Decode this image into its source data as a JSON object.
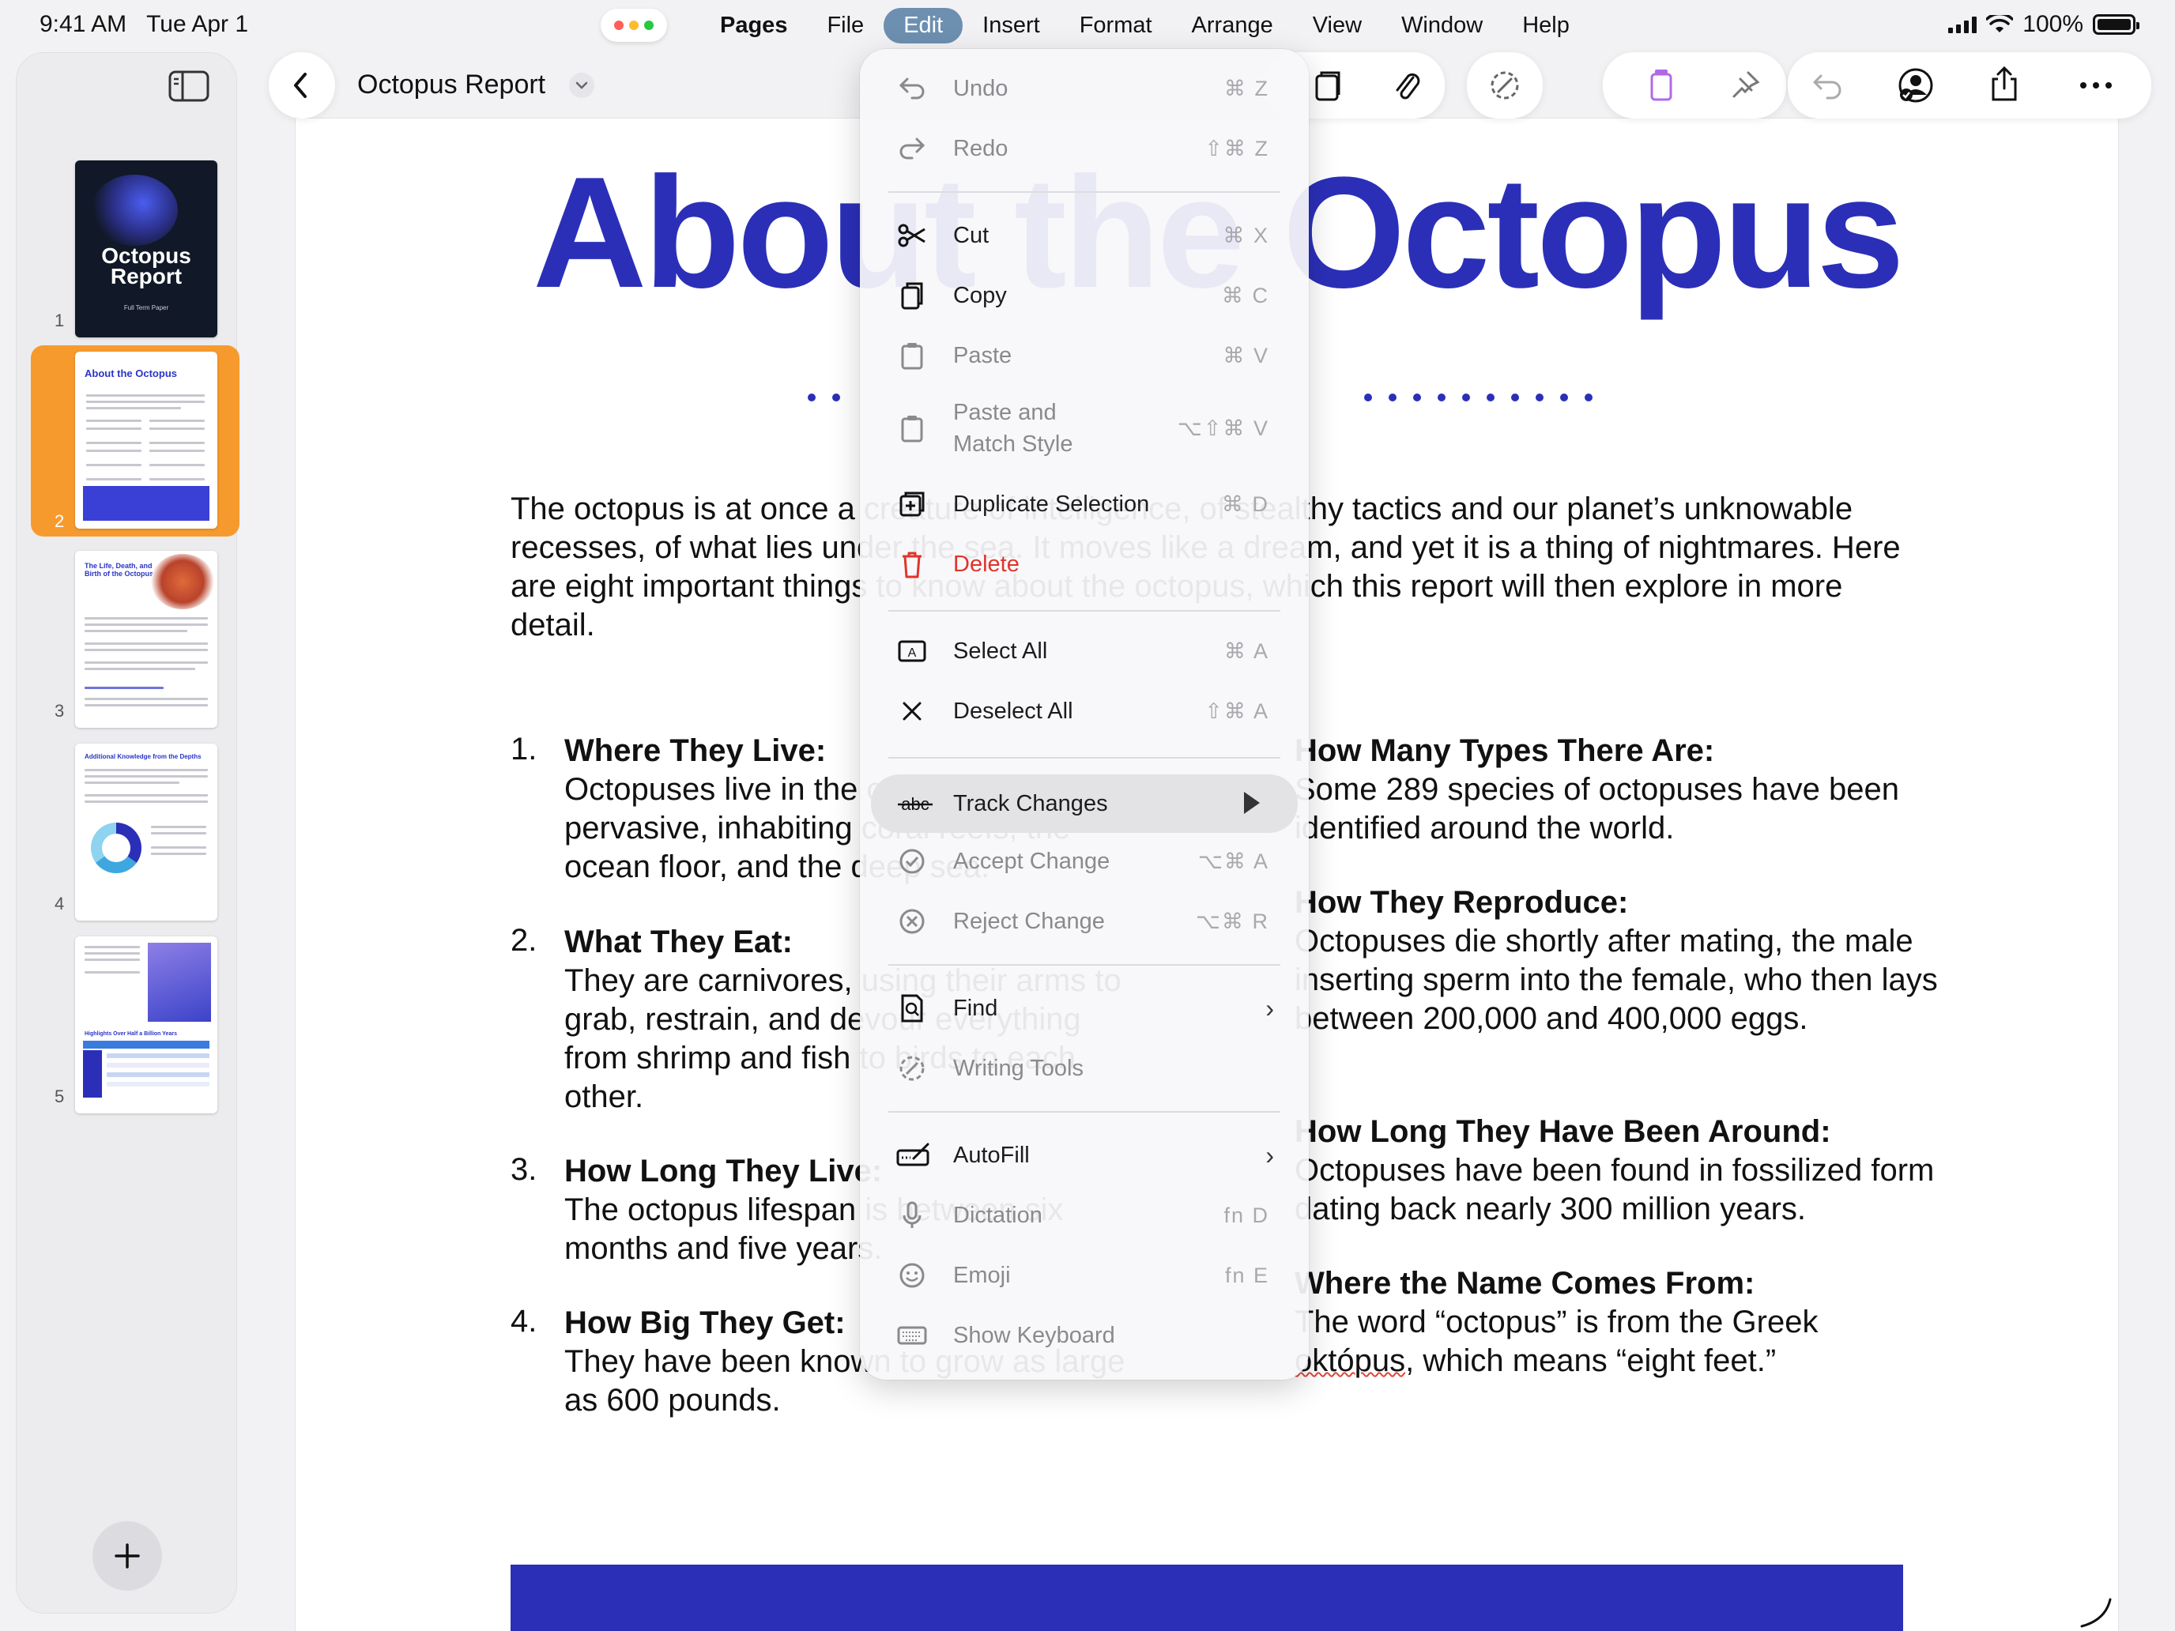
{
  "status": {
    "time": "9:41 AM",
    "date": "Tue Apr 1",
    "battery": "100%"
  },
  "menubar": {
    "items": [
      "Pages",
      "File",
      "Edit",
      "Insert",
      "Format",
      "Arrange",
      "View",
      "Window",
      "Help"
    ],
    "active": "Edit"
  },
  "toolbar": {
    "doc_title": "Octopus Report"
  },
  "sidebar": {
    "pages": [
      {
        "num": "1",
        "cover_title": "Octopus Report",
        "cover_sub": "Full Term Paper"
      },
      {
        "num": "2",
        "title": "About the Octopus"
      },
      {
        "num": "3",
        "title": "The Life, Death, and Birth of the Octopus"
      },
      {
        "num": "4",
        "title": "Additional Knowledge from the Depths"
      },
      {
        "num": "5",
        "title": "Highlights Over Half a Billion Years"
      }
    ],
    "selected_page": "2"
  },
  "document": {
    "heading": "About the Octopus",
    "intro": "The octopus is at once a creature of intelligence, of stealthy tactics and our planet’s unknowable recesses, of what lies under the sea. It moves like a dream, and yet it is a thing of nightmares. Here are eight important things to know about the octopus, which this report will then explore in more detail.",
    "left_list": [
      {
        "num": "1.",
        "title": "Where They Live:",
        "body": "Octopuses live in the ocean and are pervasive, inhabiting coral reefs, the ocean floor, and the deep sea."
      },
      {
        "num": "2.",
        "title": "What They Eat:",
        "body": "They are carnivores, using their arms to grab, restrain, and devour everything from shrimp and fish to birds to each other."
      },
      {
        "num": "3.",
        "title": "How Long They Live:",
        "body": "The octopus lifespan is between six months and five years."
      },
      {
        "num": "4.",
        "title": "How Big They Get:",
        "body": "They have been known to grow as large as 600 pounds."
      }
    ],
    "right_list": [
      {
        "title": "How Many Types There Are:",
        "body": "Some 289 species of octopuses have been identified around the world."
      },
      {
        "title": "How They Reproduce:",
        "body": "Octopuses die shortly after mating, the male inserting sperm into the female, who then lays between 200,000 and 400,000 eggs."
      },
      {
        "title": "How Long They Have Been Around:",
        "body": "Octopuses have been found in fossilized form dating back nearly 300 million years."
      },
      {
        "title": "Where the Name Comes From:",
        "body_pre": "The word “octopus” is from the Greek ",
        "body_word": "októpus",
        "body_post": ", which means “eight feet.”"
      }
    ]
  },
  "edit_menu": {
    "items": [
      {
        "label": "Undo",
        "shortcut": "⌘ Z"
      },
      {
        "label": "Redo",
        "shortcut": "⇧⌘ Z"
      },
      {
        "label": "Cut",
        "shortcut": "⌘ X"
      },
      {
        "label": "Copy",
        "shortcut": "⌘ C"
      },
      {
        "label": "Paste",
        "shortcut": "⌘ V"
      },
      {
        "label": "Paste and\nMatch Style",
        "shortcut": "⌥⇧⌘ V"
      },
      {
        "label": "Duplicate Selection",
        "shortcut": "⌘ D"
      },
      {
        "label": "Delete",
        "shortcut": ""
      },
      {
        "label": "Select All",
        "shortcut": "⌘ A"
      },
      {
        "label": "Deselect All",
        "shortcut": "⇧⌘ A"
      },
      {
        "label": "Track Changes",
        "shortcut": ""
      },
      {
        "label": "Accept Change",
        "shortcut": "⌥⌘ A"
      },
      {
        "label": "Reject Change",
        "shortcut": "⌥⌘ R"
      },
      {
        "label": "Find",
        "shortcut": ""
      },
      {
        "label": "Writing Tools",
        "shortcut": ""
      },
      {
        "label": "AutoFill",
        "shortcut": ""
      },
      {
        "label": "Dictation",
        "shortcut": "fn D"
      },
      {
        "label": "Emoji",
        "shortcut": "fn E"
      },
      {
        "label": "Show Keyboard",
        "shortcut": ""
      }
    ]
  },
  "colors": {
    "accent": "#2b2fb8",
    "selection": "#f79a2e",
    "delete": "#e0342a",
    "menu_active": "#6d8fb0"
  }
}
